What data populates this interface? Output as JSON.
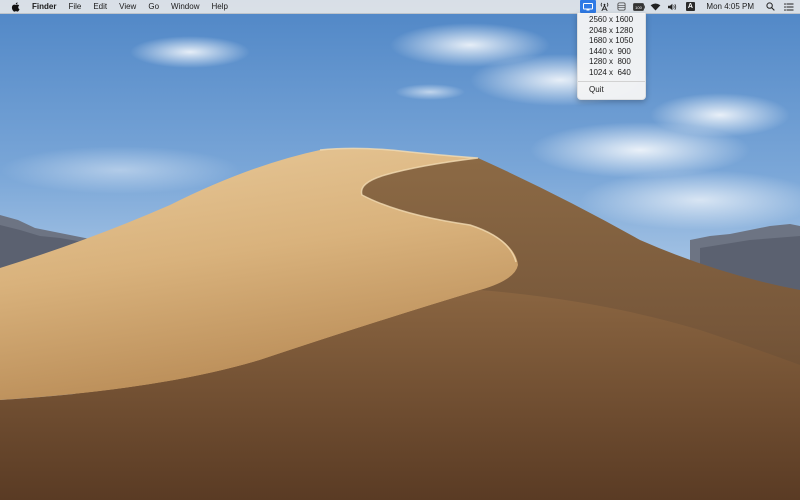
{
  "menubar": {
    "apple_icon": "apple-logo-icon",
    "app_name": "Finder",
    "menus": [
      "File",
      "Edit",
      "View",
      "Go",
      "Window",
      "Help"
    ],
    "status_icons": [
      "display-icon",
      "network-tower-icon",
      "vpn-icon",
      "battery-icon",
      "wifi-icon",
      "volume-icon",
      "input-source-icon"
    ],
    "input_source_label": "A",
    "battery_label": "100",
    "clock": "Mon 4:05 PM",
    "accent_color": "#2f7ae5"
  },
  "resolution_menu": {
    "items": [
      "2560 x 1600",
      "2048 x 1280",
      "1680 x 1050",
      "1440 x  900",
      "1280 x  800",
      "1024 x  640"
    ],
    "quit_label": "Quit"
  }
}
